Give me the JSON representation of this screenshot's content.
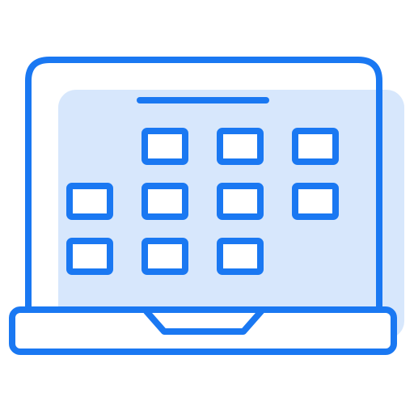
{
  "icon": {
    "name": "laptop-calendar-icon",
    "depicts": "laptop-with-calendar-grid",
    "colors": {
      "stroke": "#1a78f2",
      "fill": "#d7e7fc",
      "background": "#ffffff"
    },
    "calendar": {
      "rows": [
        [
          false,
          true,
          true,
          true
        ],
        [
          true,
          true,
          true,
          true
        ],
        [
          true,
          true,
          true,
          false
        ]
      ]
    }
  }
}
